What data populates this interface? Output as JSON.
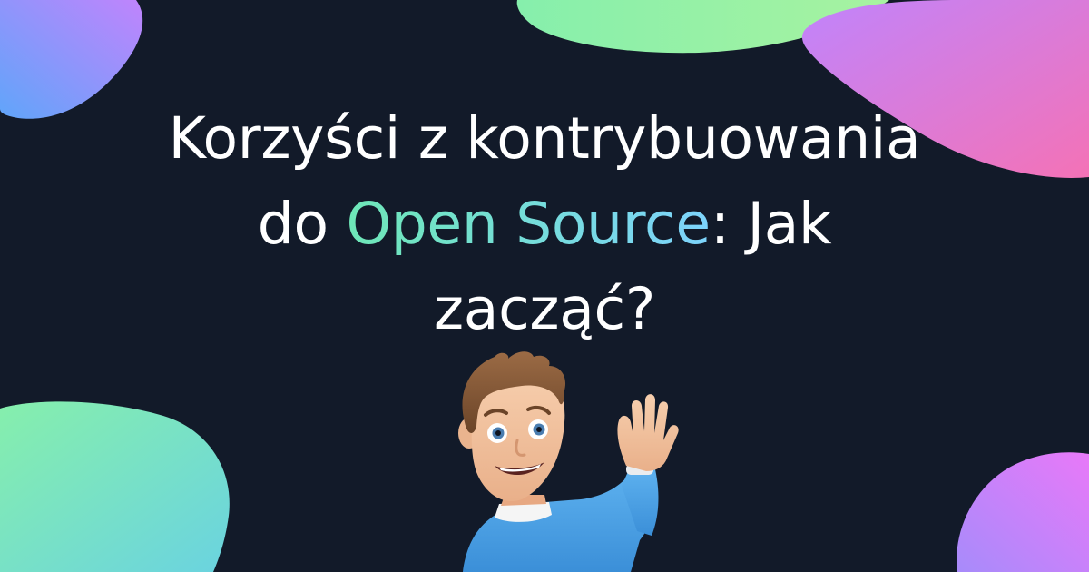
{
  "title": {
    "line1": "Korzyści z kontrybuowania",
    "line2_prefix": "do ",
    "line2_highlight": "Open Source",
    "line2_suffix": ": Jak",
    "line3": "zacząć?"
  },
  "colors": {
    "background": "#121a29",
    "text": "#ffffff",
    "highlight_start": "#6ee7b7",
    "highlight_end": "#7dd3fc",
    "blob_purple": "#c084fc",
    "blob_pink": "#f472b6",
    "blob_green": "#86efac",
    "blob_blue": "#60a5fa"
  },
  "decor": {
    "avatar": "waving-boy-memoji"
  }
}
